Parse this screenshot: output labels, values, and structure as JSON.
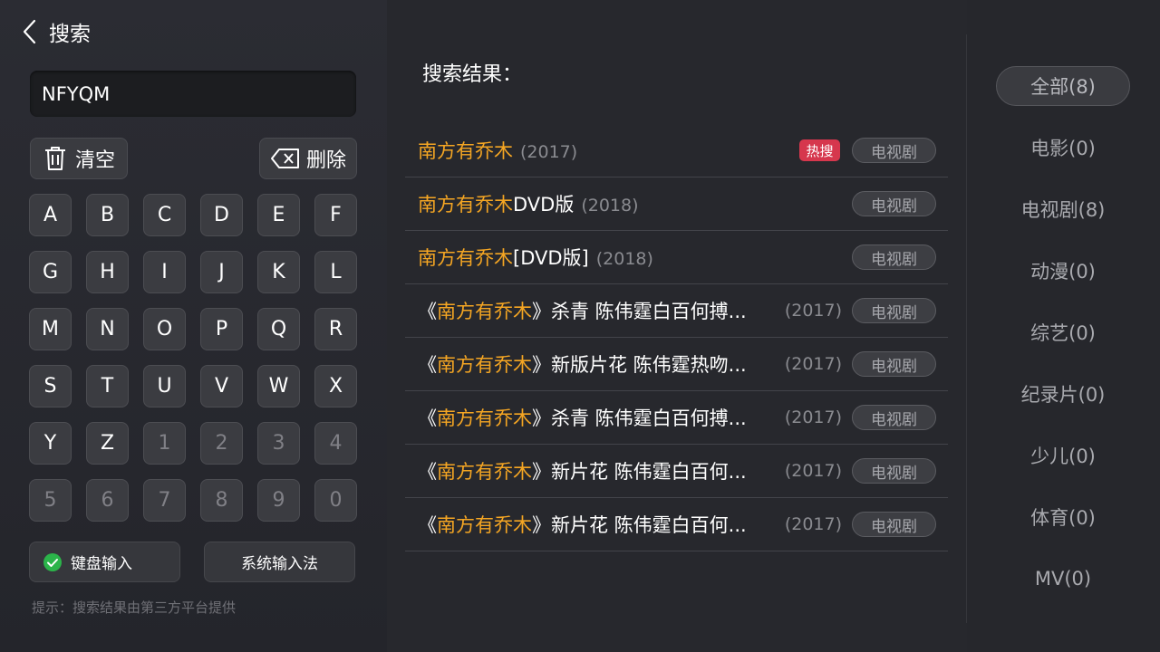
{
  "header": {
    "title": "搜索"
  },
  "search": {
    "value": "NFYQM"
  },
  "actions": {
    "clear_label": "清空",
    "delete_label": "删除"
  },
  "keyboard": {
    "rows": [
      [
        "A",
        "B",
        "C",
        "D",
        "E",
        "F"
      ],
      [
        "G",
        "H",
        "I",
        "J",
        "K",
        "L"
      ],
      [
        "M",
        "N",
        "O",
        "P",
        "Q",
        "R"
      ],
      [
        "S",
        "T",
        "U",
        "V",
        "W",
        "X"
      ],
      [
        "Y",
        "Z",
        "1",
        "2",
        "3",
        "4"
      ],
      [
        "5",
        "6",
        "7",
        "8",
        "9",
        "0"
      ]
    ],
    "disabled_keys": [
      "1",
      "2",
      "3",
      "4",
      "5",
      "6",
      "7",
      "8",
      "9",
      "0"
    ]
  },
  "input_methods": {
    "keyboard_label": "键盘输入",
    "system_label": "系统输入法",
    "selected": "键盘输入"
  },
  "tip": "提示：搜索结果由第三方平台提供",
  "results_title": "搜索结果：",
  "results": [
    {
      "prefix": "",
      "highlight": "南方有乔木",
      "suffix": "",
      "year": "(2017)",
      "tag": "电视剧",
      "hot": "热搜"
    },
    {
      "prefix": "",
      "highlight": "南方有乔木",
      "suffix": "DVD版",
      "year": "(2018)",
      "tag": "电视剧",
      "hot": ""
    },
    {
      "prefix": "",
      "highlight": "南方有乔木",
      "suffix": "[DVD版]",
      "year": "(2018)",
      "tag": "电视剧",
      "hot": ""
    },
    {
      "prefix": "《",
      "highlight": "南方有乔木",
      "suffix": "》杀青 陈伟霆白百何搏...",
      "year": "(2017)",
      "tag": "电视剧",
      "hot": ""
    },
    {
      "prefix": "《",
      "highlight": "南方有乔木",
      "suffix": "》新版片花 陈伟霆热吻...",
      "year": "(2017)",
      "tag": "电视剧",
      "hot": ""
    },
    {
      "prefix": "《",
      "highlight": "南方有乔木",
      "suffix": "》杀青 陈伟霆白百何搏...",
      "year": "(2017)",
      "tag": "电视剧",
      "hot": ""
    },
    {
      "prefix": "《",
      "highlight": "南方有乔木",
      "suffix": "》新片花 陈伟霆白百何...",
      "year": "(2017)",
      "tag": "电视剧",
      "hot": ""
    },
    {
      "prefix": "《",
      "highlight": "南方有乔木",
      "suffix": "》新片花 陈伟霆白百何...",
      "year": "(2017)",
      "tag": "电视剧",
      "hot": ""
    }
  ],
  "categories": [
    {
      "label": "全部(8)",
      "active": true
    },
    {
      "label": "电影(0)",
      "active": false
    },
    {
      "label": "电视剧(8)",
      "active": false
    },
    {
      "label": "动漫(0)",
      "active": false
    },
    {
      "label": "综艺(0)",
      "active": false
    },
    {
      "label": "纪录片(0)",
      "active": false
    },
    {
      "label": "少儿(0)",
      "active": false
    },
    {
      "label": "体育(0)",
      "active": false
    },
    {
      "label": "MV(0)",
      "active": false
    }
  ],
  "colors": {
    "highlight": "#f5a623",
    "hot_badge": "#d6374d",
    "check": "#2bb44a"
  },
  "icons": {
    "back": "chevron-left-icon",
    "clear": "trash-icon",
    "delete": "backspace-icon",
    "check": "check-circle-icon"
  }
}
